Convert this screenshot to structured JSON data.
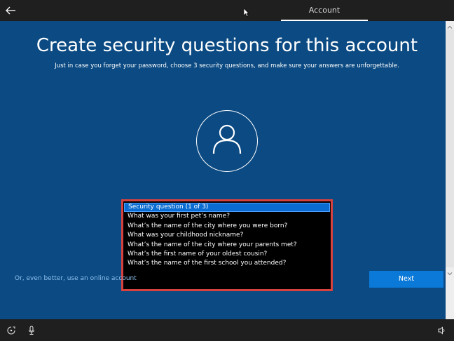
{
  "header": {
    "tab_label": "Account"
  },
  "icons": {
    "back": "back-arrow-icon",
    "cursor": "mouse-pointer-icon",
    "avatar": "user-icon",
    "ease_of_access": "ease-of-access-icon",
    "microphone": "microphone-icon",
    "volume": "volume-icon"
  },
  "page": {
    "title": "Create security questions for this account",
    "subtitle": "Just in case you forget your password, choose 3 security questions, and make sure your answers are unforgettable."
  },
  "dropdown": {
    "items": [
      {
        "label": "Security question (1 of 3)",
        "selected": true
      },
      {
        "label": "What was your first pet’s name?"
      },
      {
        "label": "What’s the name of the city where you were born?"
      },
      {
        "label": "What was your childhood nickname?"
      },
      {
        "label": "What’s the name of the city where your parents met?"
      },
      {
        "label": "What’s the first name of your oldest cousin?"
      },
      {
        "label": "What’s the name of the first school you attended?"
      }
    ]
  },
  "footer": {
    "online_link": "Or, even better, use an online account",
    "next_label": "Next"
  },
  "colors": {
    "background": "#0b4a82",
    "bar": "#1f1f1f",
    "accent": "#0a79d8",
    "highlight_border": "#d9413e",
    "link": "#8fc0ef"
  }
}
